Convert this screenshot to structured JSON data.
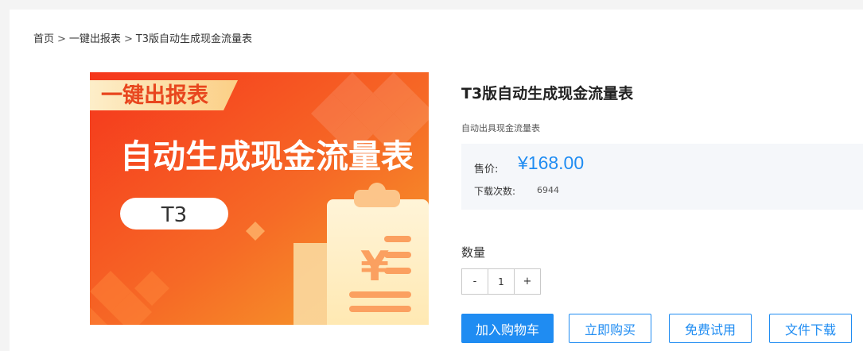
{
  "breadcrumb": {
    "items": [
      "首页",
      "一键出报表",
      "T3版自动生成现金流量表"
    ],
    "separator": ">"
  },
  "banner": {
    "tag": "一键出报表",
    "headline": "自动生成现金流量表",
    "version": "T3",
    "currency_symbol": "¥",
    "colors": {
      "bg_start": "#f5411e",
      "bg_end": "#f7a02a",
      "tag_bg": "#fde3b2"
    }
  },
  "product": {
    "title": "T3版自动生成现金流量表",
    "subtitle": "自动出具现金流量表",
    "price_label": "售价:",
    "price": "¥168.00",
    "downloads_label": "下载次数:",
    "downloads": "6944"
  },
  "quantity": {
    "label": "数量",
    "minus": "-",
    "value": "1",
    "plus": "+"
  },
  "actions": {
    "add_to_cart": "加入购物车",
    "buy_now": "立即购买",
    "free_trial": "免费试用",
    "download": "文件下载"
  },
  "colors": {
    "accent": "#1f8cf2"
  }
}
